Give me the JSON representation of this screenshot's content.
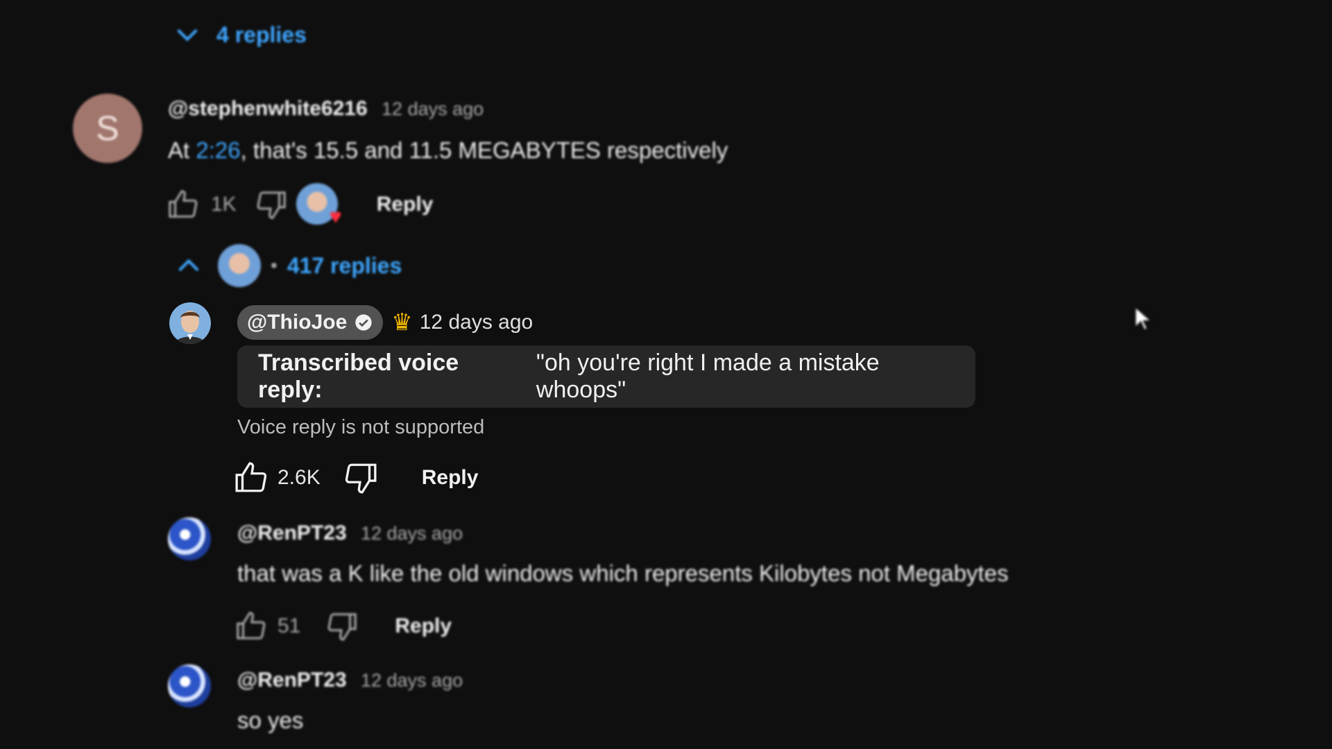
{
  "top_thread": {
    "replies_label": "4 replies"
  },
  "parent_comment": {
    "avatar_letter": "S",
    "author": "@stephenwhite6216",
    "time": "12 days ago",
    "text_prefix": "At ",
    "timestamp_link": "2:26",
    "text_suffix": ", that's 15.5 and 11.5 MEGABYTES respectively",
    "likes": "1K",
    "reply_label": "Reply",
    "replies_label": "417 replies",
    "dot": "•"
  },
  "creator_reply": {
    "author": "@ThioJoe",
    "time": "12 days ago",
    "transcript_lead": "Transcribed voice reply:",
    "transcript_text": "\"oh you're right I made a mistake whoops\"",
    "voice_note": "Voice reply is not supported",
    "likes": "2.6K",
    "reply_label": "Reply"
  },
  "replies": [
    {
      "author": "@RenPT23",
      "time": "12 days ago",
      "text": "that was a K like the old windows which represents Kilobytes not Megabytes",
      "likes": "51",
      "reply_label": "Reply"
    },
    {
      "author": "@RenPT23",
      "time": "12 days ago",
      "text": "so yes"
    }
  ],
  "icons": {
    "chevron_down": "chevron-down-icon",
    "chevron_up": "chevron-up-icon",
    "like": "thumbs-up-icon",
    "dislike": "thumbs-down-icon",
    "verified": "verified-check-icon",
    "crown": "crown-icon",
    "heart": "heart-icon",
    "cursor": "mouse-pointer-icon"
  },
  "colors": {
    "background": "#0f0f0f",
    "link_blue": "#3ea6ff",
    "chip_gray": "#525252",
    "transcript_bg": "#272727",
    "heart_red": "#ff2d3b",
    "crown_gold": "#f5b800"
  }
}
